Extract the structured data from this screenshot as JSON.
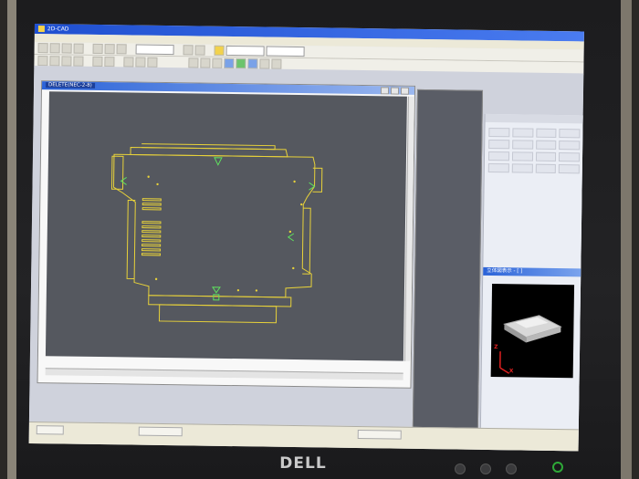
{
  "window": {
    "title": "2D-CAD"
  },
  "document": {
    "title": "DELETE(NEC-2-8)"
  },
  "view_panel": {
    "title": "立体図表示 - [ ]"
  },
  "axes": {
    "z": "Z",
    "x": "X"
  },
  "brand": {
    "logo": "DELL"
  },
  "colors": {
    "cad_outline": "#e8d23a",
    "cad_markers": "#5fe05f",
    "canvas_bg": "#55585f",
    "title_blue": "#2b63d8",
    "power_led": "#2eaa38"
  },
  "toolbar_icons": [
    "new-icon",
    "open-icon",
    "save-icon",
    "print-icon",
    "cut-icon",
    "copy-icon",
    "paste-icon",
    "undo-icon",
    "redo-icon",
    "zoom-icon",
    "pan-icon",
    "layer-icon"
  ],
  "status": {
    "field1": "",
    "field2": "",
    "field3": ""
  }
}
